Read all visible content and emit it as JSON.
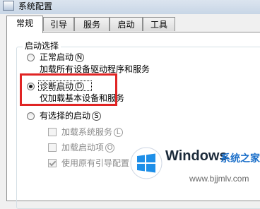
{
  "window": {
    "title": "系统配置"
  },
  "tabs": [
    {
      "label": "常规",
      "active": true
    },
    {
      "label": "引导"
    },
    {
      "label": "服务"
    },
    {
      "label": "启动"
    },
    {
      "label": "工具"
    }
  ],
  "startup_selection": {
    "group_label": "启动选择",
    "normal": {
      "label": "正常启动",
      "hotkey": "N",
      "description": "加载所有设备驱动程序和服务",
      "selected": false
    },
    "diagnostic": {
      "label": "诊断启动",
      "hotkey": "D",
      "description": "仅加载基本设备和服务",
      "selected": true
    },
    "selective": {
      "label": "有选择的启动",
      "hotkey": "S",
      "selected": false,
      "options": [
        {
          "label": "加载系统服务",
          "hotkey": "L",
          "checked": false
        },
        {
          "label": "加载启动项",
          "hotkey": "O",
          "checked": false
        },
        {
          "label": "使用原有引导配置",
          "checked": true
        }
      ]
    }
  },
  "watermark": {
    "brand": "Windows",
    "brand_suffix": "系统之家",
    "url": "www.bjjmlv.com"
  },
  "colors": {
    "highlight": "#e02424",
    "accent": "#1b6fc9"
  }
}
